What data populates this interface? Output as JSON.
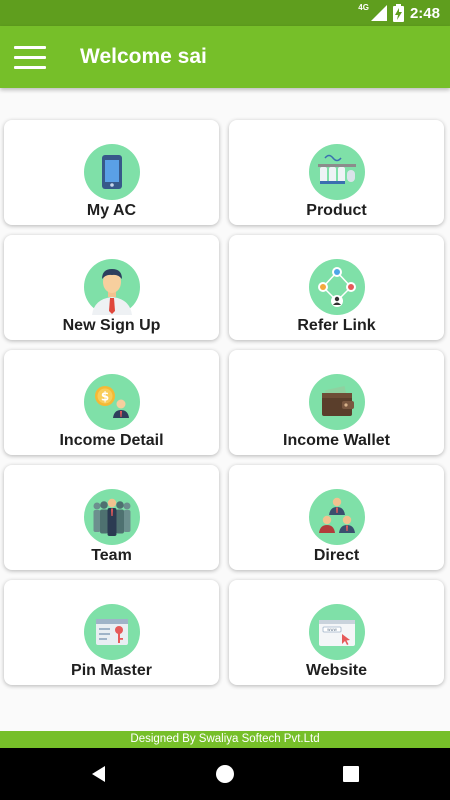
{
  "status_bar": {
    "network": "4G",
    "time": "2:48"
  },
  "app_bar": {
    "title": "Welcome sai",
    "menu_icon": "hamburger-menu-icon"
  },
  "tiles": [
    {
      "label": "My AC",
      "icon": "mobile-phone-icon"
    },
    {
      "label": "Product",
      "icon": "water-purifier-icon"
    },
    {
      "label": "New Sign Up",
      "icon": "user-avatar-icon"
    },
    {
      "label": "Refer Link",
      "icon": "share-network-icon"
    },
    {
      "label": "Income Detail",
      "icon": "dollar-coin-person-icon"
    },
    {
      "label": "Income Wallet",
      "icon": "wallet-icon"
    },
    {
      "label": "Team",
      "icon": "team-people-icon"
    },
    {
      "label": "Direct",
      "icon": "group-people-icon"
    },
    {
      "label": "Pin Master",
      "icon": "pin-key-icon"
    },
    {
      "label": "Website",
      "icon": "web-browser-icon"
    }
  ],
  "footer": {
    "text": "Designed By Swaliya Softech Pvt.Ltd"
  },
  "colors": {
    "status_bar": "#5f9e1e",
    "app_bar": "#76bf29",
    "icon_circle": "#7fe0a8"
  }
}
